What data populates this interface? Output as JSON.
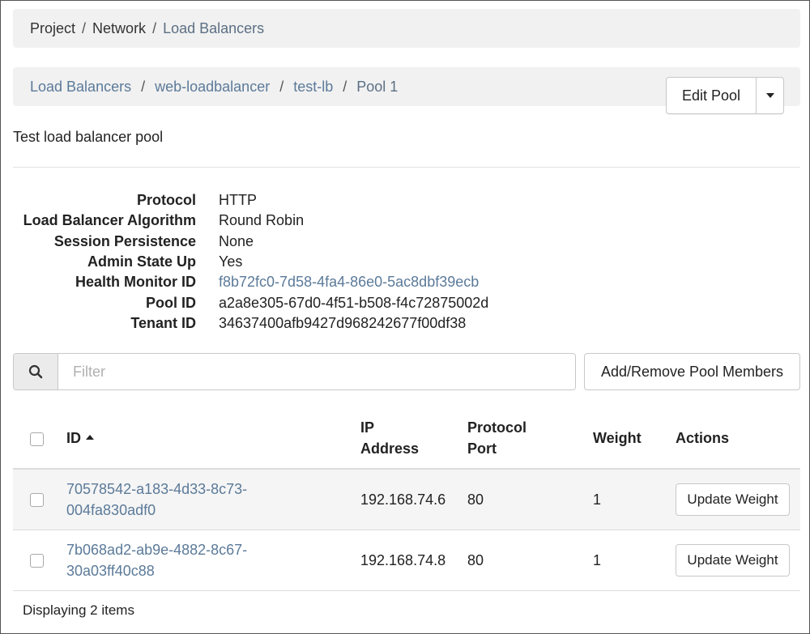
{
  "breadcrumb": {
    "items": [
      "Project",
      "Network",
      "Load Balancers"
    ]
  },
  "pool_breadcrumb": {
    "items": [
      "Load Balancers",
      "web-loadbalancer",
      "test-lb"
    ],
    "current": "Pool 1"
  },
  "actions": {
    "edit_label": "Edit Pool",
    "dropdown_icon": "caret-down-icon"
  },
  "description": "Test load balancer pool",
  "details": [
    {
      "label": "Protocol",
      "value": "HTTP"
    },
    {
      "label": "Load Balancer Algorithm",
      "value": "Round Robin"
    },
    {
      "label": "Session Persistence",
      "value": "None"
    },
    {
      "label": "Admin State Up",
      "value": "Yes"
    },
    {
      "label": "Health Monitor ID",
      "value": "f8b72fc0-7d58-4fa4-86e0-5ac8dbf39ecb"
    },
    {
      "label": "Pool ID",
      "value": "a2a8e305-67d0-4f51-b508-f4c72875002d"
    },
    {
      "label": "Tenant ID",
      "value": "34637400afb9427d968242677f00df38"
    }
  ],
  "filter": {
    "placeholder": "Filter",
    "value": "",
    "icon": "search-icon"
  },
  "add_remove_label": "Add/Remove Pool Members",
  "table": {
    "headers": {
      "id": "ID",
      "ip_line1": "IP",
      "ip_line2": "Address",
      "port_line1": "Protocol",
      "port_line2": "Port",
      "weight": "Weight",
      "actions": "Actions"
    },
    "rows": [
      {
        "id_line1": "70578542-a183-4d33-8c73-",
        "id_line2": "004fa830adf0",
        "ip": "192.168.74.6",
        "port": "80",
        "weight": "1",
        "action": "Update Weight"
      },
      {
        "id_line1": "7b068ad2-ab9e-4882-8c67-",
        "id_line2": "30a03ff40c88",
        "ip": "192.168.74.8",
        "port": "80",
        "weight": "1",
        "action": "Update Weight"
      }
    ]
  },
  "footer": "Displaying 2 items",
  "colors": {
    "link": "#5b7a99",
    "panel_bg": "#f1f1f1",
    "row_stripe": "#f5f5f5"
  }
}
